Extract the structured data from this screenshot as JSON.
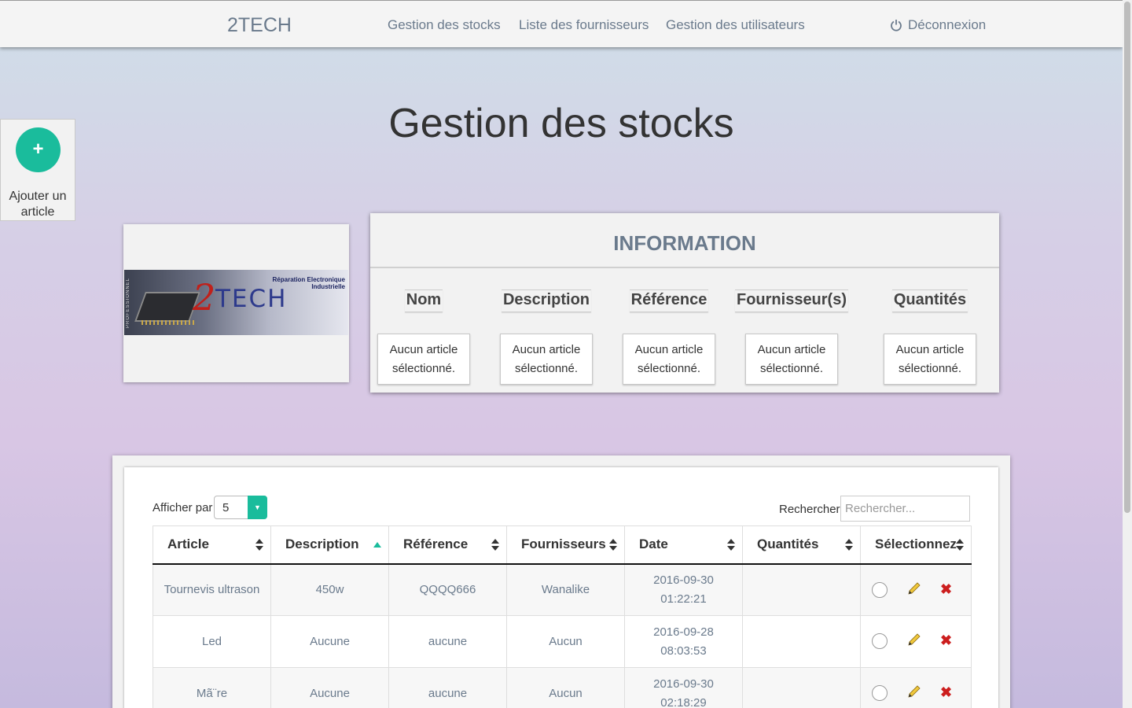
{
  "navbar": {
    "brand": "2TECH",
    "links": [
      "Gestion des stocks",
      "Liste des fournisseurs",
      "Gestion des utilisateurs"
    ],
    "logout": "Déconnexion"
  },
  "add_article": {
    "icon": "plus-icon",
    "label": "Ajouter un article"
  },
  "page_title": "Gestion des stocks",
  "logo": {
    "text_main": "TECH",
    "text_digit": "2",
    "tagline": "Réparation Electronique Industrielle",
    "vertical": "PROFESSIONNEL"
  },
  "information": {
    "title": "INFORMATION",
    "fields": [
      {
        "label": "Nom",
        "value": "Aucun article sélectionné."
      },
      {
        "label": "Description",
        "value": "Aucun article sélectionné."
      },
      {
        "label": "Référence",
        "value": "Aucun article sélectionné."
      },
      {
        "label": "Fournisseur(s)",
        "value": "Aucun article sélectionné."
      },
      {
        "label": "Quantités",
        "value": "Aucun article sélectionné."
      }
    ]
  },
  "table_controls": {
    "per_page_label": "Afficher par",
    "per_page_value": "5",
    "search_label": "Rechercher:",
    "search_placeholder": "Rechercher..."
  },
  "table": {
    "headers": [
      "Article",
      "Description",
      "Référence",
      "Fournisseurs",
      "Date",
      "Quantités",
      "Sélectionnez"
    ],
    "sorted_column": "Description",
    "rows": [
      {
        "article": "Tournevis ultrason",
        "description": "450w",
        "reference": "QQQQ666",
        "fournisseurs": "Wanalike",
        "date": "2016-09-30",
        "time": "01:22:21",
        "quantites": ""
      },
      {
        "article": "Led",
        "description": "Aucune",
        "reference": "aucune",
        "fournisseurs": "Aucun",
        "date": "2016-09-28",
        "time": "08:03:53",
        "quantites": ""
      },
      {
        "article": "Mã¨re",
        "description": "Aucune",
        "reference": "aucune",
        "fournisseurs": "Aucun",
        "date": "2016-09-30",
        "time": "02:18:29",
        "quantites": ""
      }
    ]
  },
  "colors": {
    "accent": "#1abc9c",
    "nav_text": "#6a7a8c",
    "delete": "#cc1e1e"
  }
}
